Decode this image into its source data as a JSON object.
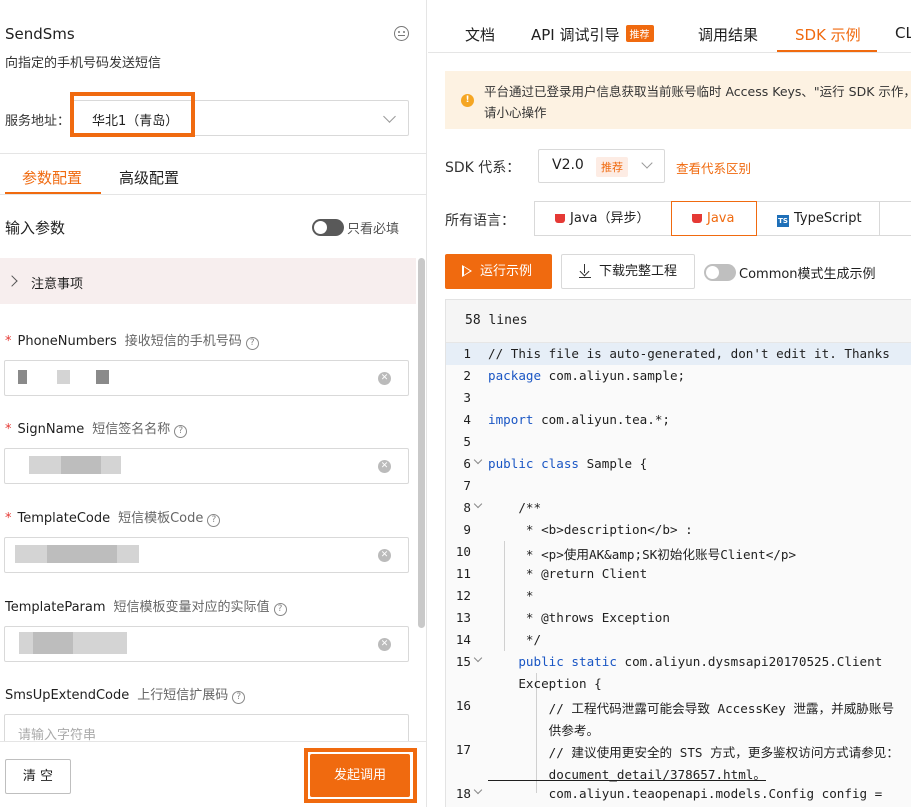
{
  "api": {
    "name": "SendSms",
    "description": "向指定的手机号码发送短信"
  },
  "service": {
    "label": "服务地址：",
    "value": "华北1（青岛）"
  },
  "config_tabs": [
    {
      "label": "参数配置"
    },
    {
      "label": "高级配置"
    }
  ],
  "params_header": {
    "title": "输入参数",
    "required_only_label": "只看必填"
  },
  "notice": {
    "label": "注意事项"
  },
  "fields": [
    {
      "name": "PhoneNumbers",
      "required": "*",
      "hint": "接收短信的手机号码",
      "q": "?"
    },
    {
      "name": "SignName",
      "required": "*",
      "hint": "短信签名名称",
      "q": "?"
    },
    {
      "name": "TemplateCode",
      "required": "*",
      "hint": "短信模板Code",
      "q": "?"
    },
    {
      "name": "TemplateParam",
      "required": "",
      "hint": "短信模板变量对应的实际值",
      "q": "?"
    },
    {
      "name": "SmsUpExtendCode",
      "required": "",
      "hint": "上行短信扩展码",
      "q": "?",
      "placeholder": "请输入字符串"
    }
  ],
  "buttons": {
    "clear": "清 空",
    "invoke": "发起调用"
  },
  "right_tabs": [
    {
      "label": "文档"
    },
    {
      "label": "API 调试引导",
      "badge": "推荐"
    },
    {
      "label": "调用结果"
    },
    {
      "label": "SDK 示例",
      "active": true
    },
    {
      "label": "CL"
    }
  ],
  "warning": {
    "text": "平台通过已登录用户信息获取当前账号临时 Access Keys、\"运行 SDK 示作，请小心操作"
  },
  "sdk": {
    "label": "SDK 代系：",
    "version": "V2.0",
    "tag": "推荐",
    "diff_link": "查看代系区别"
  },
  "languages": {
    "label": "所有语言：",
    "items": [
      "Java（异步）",
      "Java",
      "TypeScript"
    ]
  },
  "actions": {
    "run": "运行示例",
    "download": "下载完整工程",
    "common_mode": "Common模式生成示例"
  },
  "code": {
    "lines_label": "58 lines",
    "lines": [
      {
        "n": "1",
        "text": "// This file is auto-generated, don't edit it. Thanks"
      },
      {
        "n": "2",
        "text": "package com.aliyun.sample;"
      },
      {
        "n": "3",
        "text": ""
      },
      {
        "n": "4",
        "text": "import com.aliyun.tea.*;"
      },
      {
        "n": "5",
        "text": ""
      },
      {
        "n": "6",
        "text": "public class Sample {"
      },
      {
        "n": "7",
        "text": ""
      },
      {
        "n": "8",
        "text": "    /**"
      },
      {
        "n": "9",
        "text": "     * <b>description</b> :"
      },
      {
        "n": "10",
        "text": "     * <p>使用AK&amp;SK初始化账号Client</p>"
      },
      {
        "n": "11",
        "text": "     * @return Client"
      },
      {
        "n": "12",
        "text": "     *"
      },
      {
        "n": "13",
        "text": "     * @throws Exception"
      },
      {
        "n": "14",
        "text": "     */"
      },
      {
        "n": "15",
        "text": "    public static com.aliyun.dysmsapi20170525.Client"
      },
      {
        "n": "",
        "text": "    Exception {"
      },
      {
        "n": "16",
        "text": "        // 工程代码泄露可能会导致 AccessKey 泄露，并威胁账号"
      },
      {
        "n": "",
        "text": "        供参考。"
      },
      {
        "n": "17",
        "text": "        // 建议使用更安全的 STS 方式，更多鉴权访问方式请参见："
      },
      {
        "n": "",
        "text": "        document_detail/378657.html。"
      },
      {
        "n": "18",
        "text": "        com.aliyun.teaopenapi.models.Config config ="
      }
    ]
  }
}
